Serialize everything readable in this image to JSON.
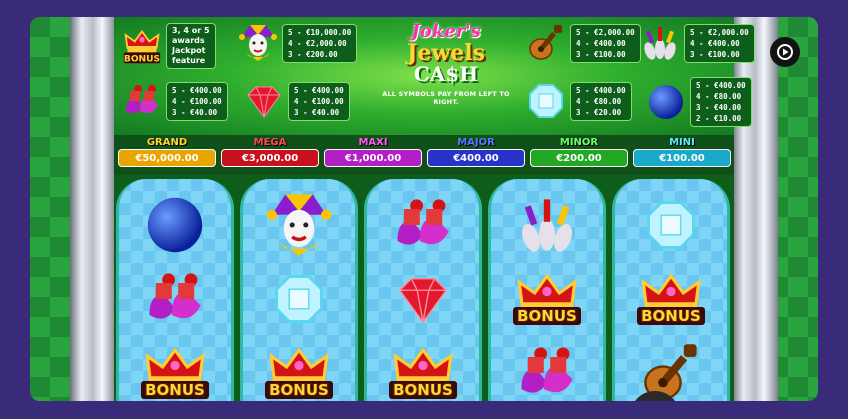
{
  "game": {
    "logo_line1": "Joker's",
    "logo_line2": "Jewels",
    "logo_line3": "CA$H",
    "pay_note": "ALL SYMBOLS PAY FROM LEFT TO RIGHT."
  },
  "paytable": {
    "bonus": {
      "symbol": "bonus-crown",
      "lines": [
        "3, 4 or 5",
        "awards",
        "Jackpot",
        "feature"
      ]
    },
    "joker": {
      "symbol": "joker",
      "lines": [
        "5 - €10,000.00",
        "4 - €2,000.00",
        "3 - €200.00"
      ]
    },
    "mandolin": {
      "symbol": "mandolin",
      "lines": [
        "5 - €2,000.00",
        "4 - €400.00",
        "3 - €100.00"
      ]
    },
    "pins": {
      "symbol": "juggling-pins",
      "lines": [
        "5 - €2,000.00",
        "4 - €400.00",
        "3 - €100.00"
      ]
    },
    "shoes": {
      "symbol": "jester-shoes",
      "lines": [
        "5 - €400.00",
        "4 - €100.00",
        "3 - €40.00"
      ]
    },
    "ruby": {
      "symbol": "ruby",
      "lines": [
        "5 - €400.00",
        "4 - €100.00",
        "3 - €40.00"
      ]
    },
    "diamond": {
      "symbol": "diamond",
      "lines": [
        "5 - €400.00",
        "4 - €80.00",
        "3 - €20.00"
      ]
    },
    "ball": {
      "symbol": "blue-ball",
      "lines": [
        "5 - €400.00",
        "4 - €80.00",
        "3 - €40.00",
        "2 - €10.00"
      ]
    }
  },
  "jackpots": [
    {
      "name": "GRAND",
      "value": "€50,000.00",
      "name_color": "#ffd733",
      "bar_color": "#e8a400"
    },
    {
      "name": "MEGA",
      "value": "€3,000.00",
      "name_color": "#ff4a4a",
      "bar_color": "#c8101e"
    },
    {
      "name": "MAXI",
      "value": "€1,000.00",
      "name_color": "#ff5cf0",
      "bar_color": "#b21fc4"
    },
    {
      "name": "MAJOR",
      "value": "€400.00",
      "name_color": "#5a7bff",
      "bar_color": "#2733c9"
    },
    {
      "name": "MINOR",
      "value": "€200.00",
      "name_color": "#6bff6b",
      "bar_color": "#22a822"
    },
    {
      "name": "MINI",
      "value": "€100.00",
      "name_color": "#5ee8ff",
      "bar_color": "#1aa9c9"
    }
  ],
  "reels": [
    [
      "blue-ball",
      "jester-shoes",
      "bonus-crown"
    ],
    [
      "joker",
      "diamond",
      "bonus-crown"
    ],
    [
      "jester-shoes",
      "ruby",
      "bonus-crown"
    ],
    [
      "juggling-pins",
      "bonus-crown",
      "jester-shoes"
    ],
    [
      "diamond",
      "bonus-crown",
      "mandolin"
    ]
  ],
  "bonus_label": "BONUS"
}
